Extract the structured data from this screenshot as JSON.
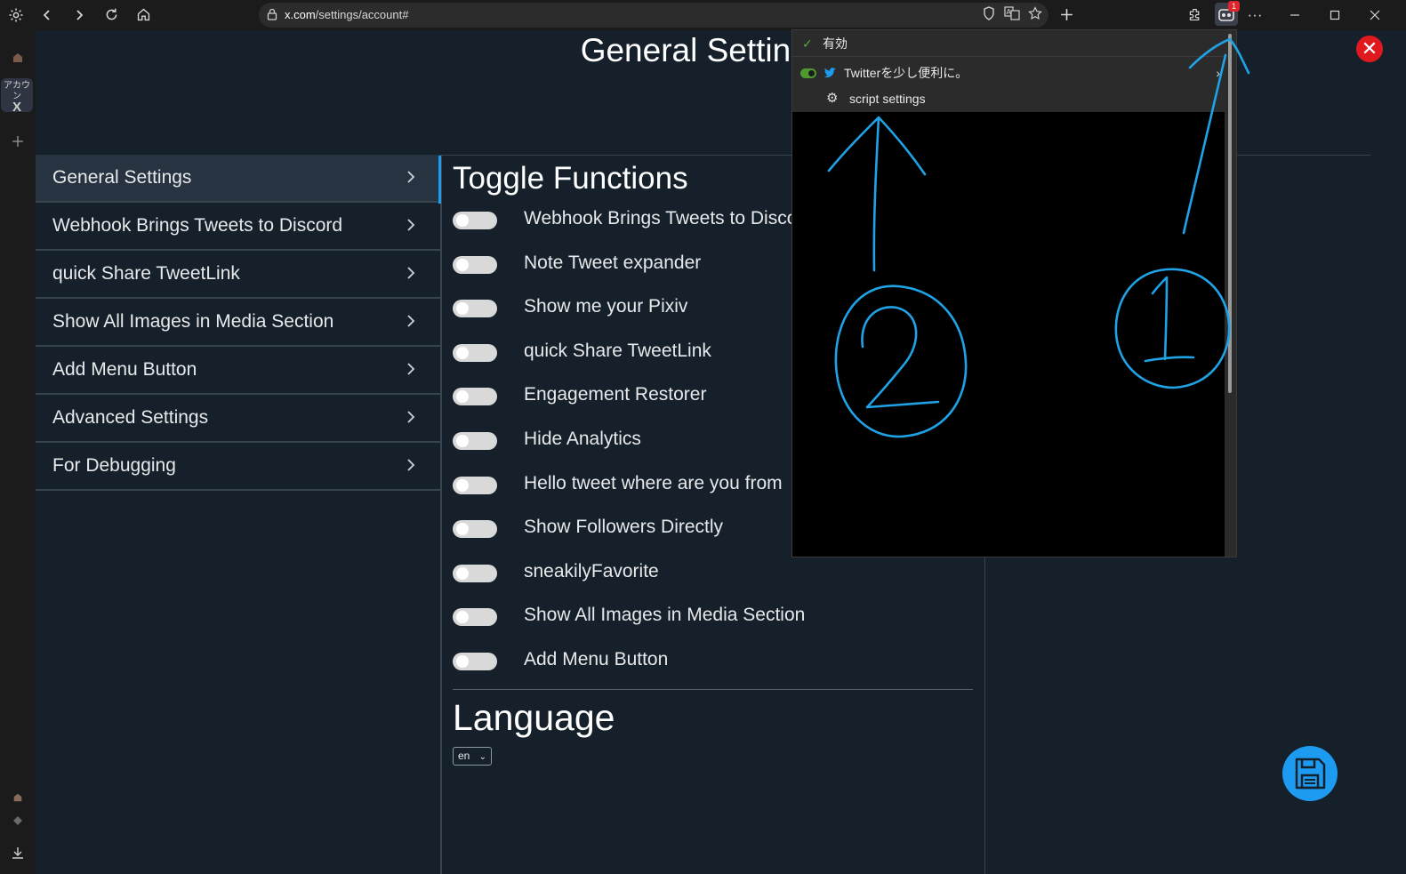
{
  "browser": {
    "url_host": "x.com",
    "url_path": "/settings/account#",
    "extension_badge": "1",
    "icons": [
      "settings-icon",
      "back-icon",
      "forward-icon",
      "reload-icon",
      "home-icon",
      "lock-icon",
      "shield-icon",
      "translate-icon",
      "star-icon",
      "new-tab-icon",
      "extensions-icon",
      "more-icon",
      "minimize-icon",
      "maximize-icon",
      "close-window-icon"
    ]
  },
  "vsidebar": {
    "x_tab_label": "アカウン",
    "x_tab_glyph": "X"
  },
  "page": {
    "title": "General Settings",
    "close_glyph": "✕"
  },
  "menu": [
    {
      "label": "General Settings",
      "active": true
    },
    {
      "label": "Webhook Brings Tweets to Discord"
    },
    {
      "label": "quick Share TweetLink"
    },
    {
      "label": "Show All Images in Media Section"
    },
    {
      "label": "Add Menu Button"
    },
    {
      "label": "Advanced Settings"
    },
    {
      "label": "For Debugging"
    }
  ],
  "toggles": {
    "section_title": "Toggle Functions",
    "items": [
      {
        "label": "Webhook Brings Tweets to Discord",
        "on": false
      },
      {
        "label": "Note Tweet expander",
        "on": false
      },
      {
        "label": "Show me your Pixiv",
        "on": false
      },
      {
        "label": "quick Share TweetLink",
        "on": false
      },
      {
        "label": "Engagement Restorer",
        "on": false
      },
      {
        "label": "Hide Analytics",
        "on": false
      },
      {
        "label": "Hello tweet where are you from",
        "on": false
      },
      {
        "label": "Show Followers Directly",
        "on": false
      },
      {
        "label": "sneakilyFavorite",
        "on": false
      },
      {
        "label": "Show All Images in Media Section",
        "on": false
      },
      {
        "label": "Add Menu Button",
        "on": false
      }
    ]
  },
  "language": {
    "section_title": "Language",
    "selected": "en"
  },
  "popup": {
    "enabled_label": "有効",
    "script_name": "Twitterを少し便利に。",
    "settings_label": "script settings",
    "annotations": [
      "1",
      "2"
    ]
  },
  "colors": {
    "page_bg": "#15202b",
    "accent": "#1d9bf0",
    "annotation": "#1fa3e6",
    "close_red": "#e0191f",
    "enabled_green": "#5aad3a"
  }
}
